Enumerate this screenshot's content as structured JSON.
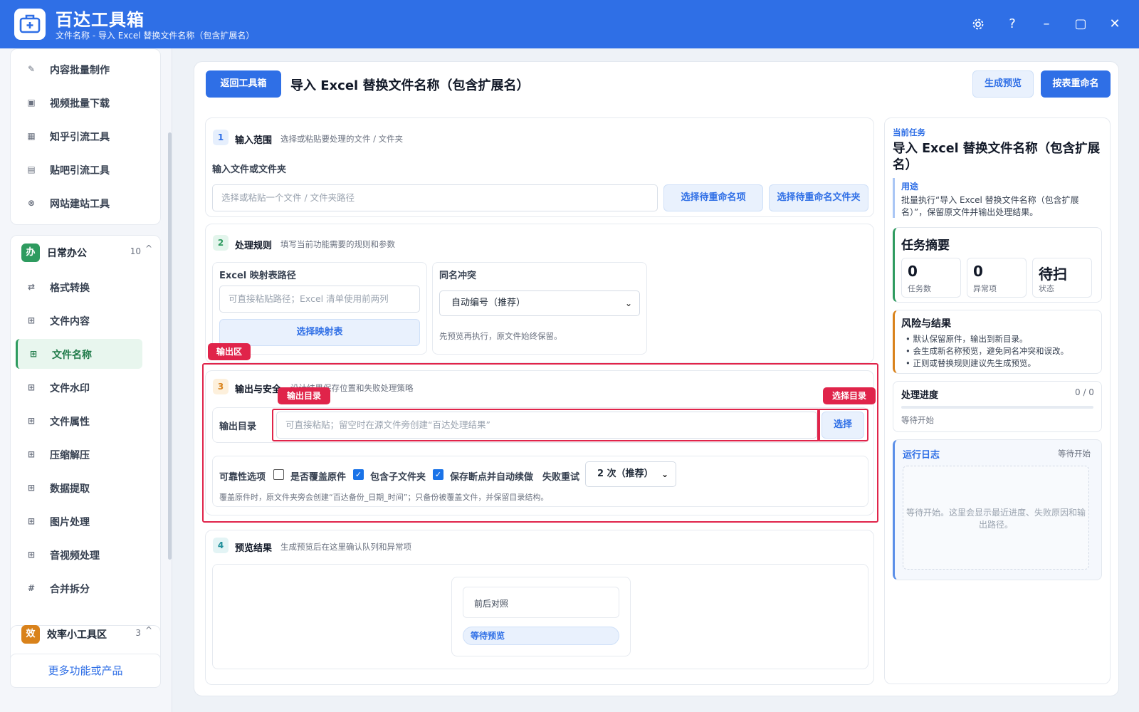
{
  "app": {
    "name": "百达工具箱",
    "subtitle": "文件名称 - 导入 Excel 替换文件名称（包含扩展名）"
  },
  "sidebar": {
    "top_items": [
      {
        "label": "内容批量制作",
        "icon": "edit-icon"
      },
      {
        "label": "视频批量下载",
        "icon": "video-icon"
      },
      {
        "label": "知乎引流工具",
        "icon": "zhihu-icon"
      },
      {
        "label": "贴吧引流工具",
        "icon": "tieba-icon"
      },
      {
        "label": "网站建站工具",
        "icon": "globe-icon"
      }
    ],
    "group_office": {
      "badge": "办",
      "name": "日常办公",
      "count": "10",
      "color": "#2e9b5f"
    },
    "office_items": [
      {
        "label": "格式转换",
        "icon": "convert-icon"
      },
      {
        "label": "文件内容",
        "icon": "grid-icon"
      },
      {
        "label": "文件名称",
        "icon": "grid-icon"
      },
      {
        "label": "文件水印",
        "icon": "grid-icon"
      },
      {
        "label": "文件属性",
        "icon": "grid-icon"
      },
      {
        "label": "压缩解压",
        "icon": "grid-icon"
      },
      {
        "label": "数据提取",
        "icon": "grid-icon"
      },
      {
        "label": "图片处理",
        "icon": "grid-icon"
      },
      {
        "label": "音视频处理",
        "icon": "grid-icon"
      },
      {
        "label": "合并拆分",
        "icon": "hash-icon"
      }
    ],
    "group_efficiency": {
      "badge": "效",
      "name": "效率小工具区",
      "count": "3",
      "color": "#d9821b"
    },
    "more_label": "更多功能或产品"
  },
  "header": {
    "back_label": "返回工具箱",
    "title": "导入 Excel 替换文件名称（包含扩展名）",
    "preview_label": "生成预览",
    "rename_label": "按表重命名"
  },
  "step1": {
    "num": "1",
    "title": "输入范围",
    "desc": "选择或粘贴要处理的文件 / 文件夹",
    "label": "输入文件或文件夹",
    "placeholder": "选择或粘贴一个文件 / 文件夹路径",
    "btn_items": "选择待重命名项",
    "btn_folder": "选择待重命名文件夹"
  },
  "step2": {
    "num": "2",
    "title": "处理规则",
    "desc": "填写当前功能需要的规则和参数",
    "map_label": "Excel 映射表路径",
    "map_placeholder": "可直接粘贴路径；Excel 清单使用前两列",
    "map_btn": "选择映射表",
    "conflict_label": "同名冲突",
    "conflict_value": "自动编号（推荐）",
    "conflict_hint": "先预览再执行，原文件始终保留。"
  },
  "step3": {
    "num": "3",
    "title": "输出与安全",
    "desc": "设计结果保存位置和失败处理策略",
    "out_label": "输出目录",
    "out_placeholder": "可直接粘贴；留空时在源文件旁创建“百达处理结果”",
    "select_btn": "选择",
    "opt_title": "可靠性选项",
    "opt_overwrite": "是否覆盖原件",
    "opt_subfolder": "包含子文件夹",
    "opt_resume": "保存断点并自动续做",
    "opt_retry": "失败重试",
    "retry_value": "2 次（推荐）",
    "opt_hint": "覆盖原件时，原文件夹旁会创建“百达备份_日期_时间”；只备份被覆盖文件，并保留目录结构。"
  },
  "annotations": {
    "output_area": "输出区",
    "output_dir": "输出目录",
    "select_dir": "选择目录"
  },
  "step4": {
    "num": "4",
    "title": "预览结果",
    "desc": "生成预览后在这里确认队列和异常项",
    "compare_label": "前后对照",
    "wait_label": "等待预览"
  },
  "right": {
    "current_task_label": "当前任务",
    "current_task_title": "导入 Excel 替换文件名称（包含扩展名）",
    "purpose_label": "用途",
    "purpose_text": "批量执行“导入 Excel 替换文件名称（包含扩展名）”，保留原文件并输出处理结果。",
    "summary_title": "任务摘要",
    "stats": [
      {
        "value": "0",
        "key": "任务数"
      },
      {
        "value": "0",
        "key": "异常项"
      },
      {
        "value": "待扫",
        "key": "状态"
      }
    ],
    "risk_title": "风险与结果",
    "risks": [
      "默认保留原件，输出到新目录。",
      "会生成新名称预览，避免同名冲突和误改。",
      "正则或替换规则建议先生成预览。"
    ],
    "progress_title": "处理进度",
    "progress_value": "0 / 0",
    "progress_status": "等待开始",
    "log_title": "运行日志",
    "log_status": "等待开始",
    "log_text": "等待开始。这里会显示最近进度、失败原因和输出路径。"
  },
  "colors": {
    "accent": "#2f6fe6",
    "annotation": "#e0244a",
    "green": "#2e9b5f",
    "orange": "#d9821b"
  }
}
